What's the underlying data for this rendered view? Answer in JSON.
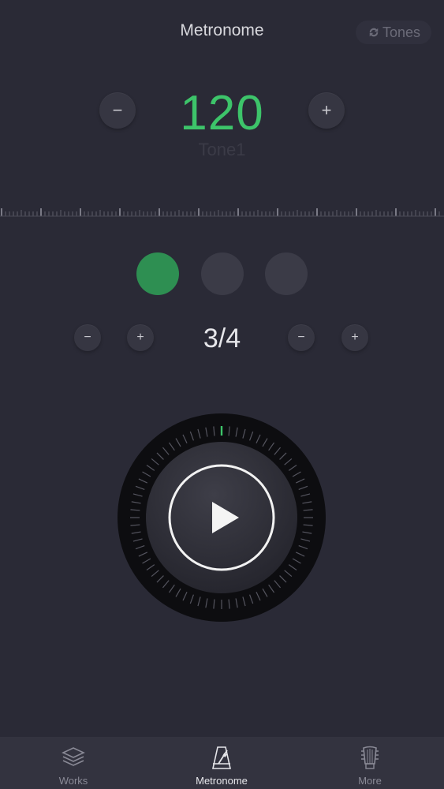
{
  "header": {
    "title": "Metronome",
    "tones_label": "Tones"
  },
  "tempo": {
    "bpm": "120",
    "tone_name": "Tone1",
    "minus": "−",
    "plus": "+"
  },
  "beats": {
    "count": 3,
    "active_index": 0,
    "time_signature": "3/4",
    "minus": "−",
    "plus": "+"
  },
  "player": {
    "state": "paused",
    "play_icon": "play-icon"
  },
  "tabbar": {
    "items": [
      {
        "label": "Works",
        "icon": "layers-icon"
      },
      {
        "label": "Metronome",
        "icon": "metronome-icon",
        "active": true
      },
      {
        "label": "More",
        "icon": "guitar-headstock-icon"
      }
    ]
  },
  "colors": {
    "background": "#2a2a36",
    "accent": "#3dc46a",
    "beat_active": "#2e8f52",
    "beat_inactive": "#3b3b47"
  }
}
